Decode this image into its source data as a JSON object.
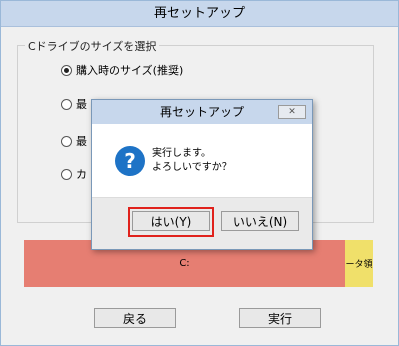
{
  "window": {
    "title": "再セットアップ"
  },
  "options": {
    "group_label": "Cドライブのサイズを選択",
    "radios": [
      {
        "label": "購入時のサイズ(推奨)",
        "checked": true
      },
      {
        "label": "最",
        "checked": false
      },
      {
        "label": "最",
        "checked": false
      },
      {
        "label": "カ",
        "checked": false
      }
    ]
  },
  "partitions": {
    "c_label": "C:",
    "recovery_label": "ータ領"
  },
  "buttons": {
    "back": "戻る",
    "execute": "実行"
  },
  "dialog": {
    "title": "再セットアップ",
    "close_glyph": "✕",
    "icon_glyph": "?",
    "message_line1": "実行します。",
    "message_line2": "よろしいですか？",
    "yes": "はい(Y)",
    "no": "いいえ(N)"
  },
  "colors": {
    "c_partition": "#e67e72",
    "recovery_partition": "#f0e06a",
    "highlight": "#e0221c",
    "question_icon": "#1e73c6"
  }
}
